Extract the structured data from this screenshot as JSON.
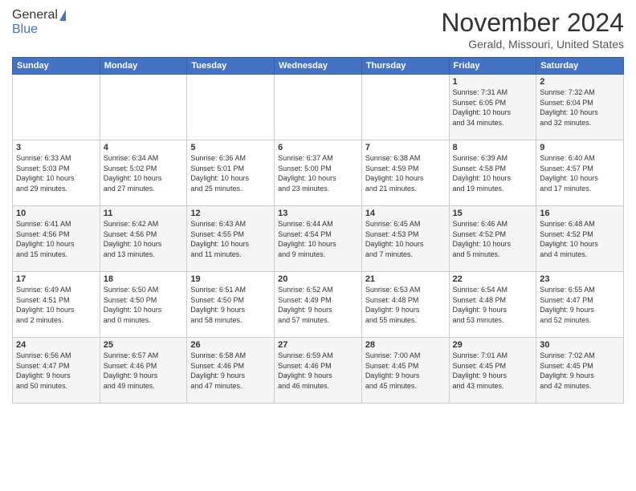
{
  "header": {
    "logo": {
      "general": "General",
      "blue": "Blue"
    },
    "title": "November 2024",
    "location": "Gerald, Missouri, United States"
  },
  "weekdays": [
    "Sunday",
    "Monday",
    "Tuesday",
    "Wednesday",
    "Thursday",
    "Friday",
    "Saturday"
  ],
  "weeks": [
    [
      {
        "day": "",
        "info": ""
      },
      {
        "day": "",
        "info": ""
      },
      {
        "day": "",
        "info": ""
      },
      {
        "day": "",
        "info": ""
      },
      {
        "day": "",
        "info": ""
      },
      {
        "day": "1",
        "info": "Sunrise: 7:31 AM\nSunset: 6:05 PM\nDaylight: 10 hours\nand 34 minutes."
      },
      {
        "day": "2",
        "info": "Sunrise: 7:32 AM\nSunset: 6:04 PM\nDaylight: 10 hours\nand 32 minutes."
      }
    ],
    [
      {
        "day": "3",
        "info": "Sunrise: 6:33 AM\nSunset: 5:03 PM\nDaylight: 10 hours\nand 29 minutes."
      },
      {
        "day": "4",
        "info": "Sunrise: 6:34 AM\nSunset: 5:02 PM\nDaylight: 10 hours\nand 27 minutes."
      },
      {
        "day": "5",
        "info": "Sunrise: 6:36 AM\nSunset: 5:01 PM\nDaylight: 10 hours\nand 25 minutes."
      },
      {
        "day": "6",
        "info": "Sunrise: 6:37 AM\nSunset: 5:00 PM\nDaylight: 10 hours\nand 23 minutes."
      },
      {
        "day": "7",
        "info": "Sunrise: 6:38 AM\nSunset: 4:59 PM\nDaylight: 10 hours\nand 21 minutes."
      },
      {
        "day": "8",
        "info": "Sunrise: 6:39 AM\nSunset: 4:58 PM\nDaylight: 10 hours\nand 19 minutes."
      },
      {
        "day": "9",
        "info": "Sunrise: 6:40 AM\nSunset: 4:57 PM\nDaylight: 10 hours\nand 17 minutes."
      }
    ],
    [
      {
        "day": "10",
        "info": "Sunrise: 6:41 AM\nSunset: 4:56 PM\nDaylight: 10 hours\nand 15 minutes."
      },
      {
        "day": "11",
        "info": "Sunrise: 6:42 AM\nSunset: 4:56 PM\nDaylight: 10 hours\nand 13 minutes."
      },
      {
        "day": "12",
        "info": "Sunrise: 6:43 AM\nSunset: 4:55 PM\nDaylight: 10 hours\nand 11 minutes."
      },
      {
        "day": "13",
        "info": "Sunrise: 6:44 AM\nSunset: 4:54 PM\nDaylight: 10 hours\nand 9 minutes."
      },
      {
        "day": "14",
        "info": "Sunrise: 6:45 AM\nSunset: 4:53 PM\nDaylight: 10 hours\nand 7 minutes."
      },
      {
        "day": "15",
        "info": "Sunrise: 6:46 AM\nSunset: 4:52 PM\nDaylight: 10 hours\nand 5 minutes."
      },
      {
        "day": "16",
        "info": "Sunrise: 6:48 AM\nSunset: 4:52 PM\nDaylight: 10 hours\nand 4 minutes."
      }
    ],
    [
      {
        "day": "17",
        "info": "Sunrise: 6:49 AM\nSunset: 4:51 PM\nDaylight: 10 hours\nand 2 minutes."
      },
      {
        "day": "18",
        "info": "Sunrise: 6:50 AM\nSunset: 4:50 PM\nDaylight: 10 hours\nand 0 minutes."
      },
      {
        "day": "19",
        "info": "Sunrise: 6:51 AM\nSunset: 4:50 PM\nDaylight: 9 hours\nand 58 minutes."
      },
      {
        "day": "20",
        "info": "Sunrise: 6:52 AM\nSunset: 4:49 PM\nDaylight: 9 hours\nand 57 minutes."
      },
      {
        "day": "21",
        "info": "Sunrise: 6:53 AM\nSunset: 4:48 PM\nDaylight: 9 hours\nand 55 minutes."
      },
      {
        "day": "22",
        "info": "Sunrise: 6:54 AM\nSunset: 4:48 PM\nDaylight: 9 hours\nand 53 minutes."
      },
      {
        "day": "23",
        "info": "Sunrise: 6:55 AM\nSunset: 4:47 PM\nDaylight: 9 hours\nand 52 minutes."
      }
    ],
    [
      {
        "day": "24",
        "info": "Sunrise: 6:56 AM\nSunset: 4:47 PM\nDaylight: 9 hours\nand 50 minutes."
      },
      {
        "day": "25",
        "info": "Sunrise: 6:57 AM\nSunset: 4:46 PM\nDaylight: 9 hours\nand 49 minutes."
      },
      {
        "day": "26",
        "info": "Sunrise: 6:58 AM\nSunset: 4:46 PM\nDaylight: 9 hours\nand 47 minutes."
      },
      {
        "day": "27",
        "info": "Sunrise: 6:59 AM\nSunset: 4:46 PM\nDaylight: 9 hours\nand 46 minutes."
      },
      {
        "day": "28",
        "info": "Sunrise: 7:00 AM\nSunset: 4:45 PM\nDaylight: 9 hours\nand 45 minutes."
      },
      {
        "day": "29",
        "info": "Sunrise: 7:01 AM\nSunset: 4:45 PM\nDaylight: 9 hours\nand 43 minutes."
      },
      {
        "day": "30",
        "info": "Sunrise: 7:02 AM\nSunset: 4:45 PM\nDaylight: 9 hours\nand 42 minutes."
      }
    ]
  ]
}
